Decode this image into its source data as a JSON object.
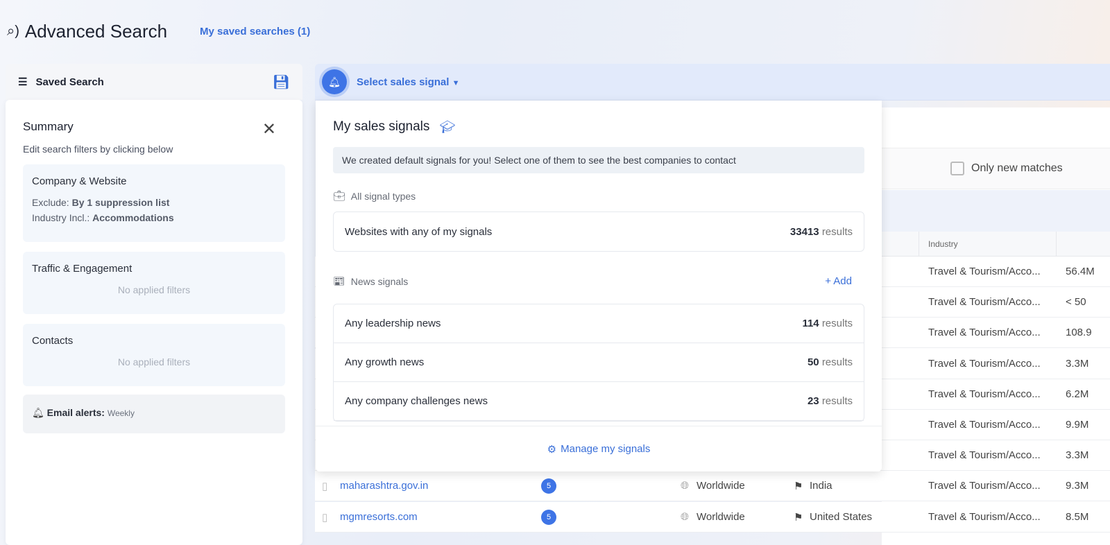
{
  "header": {
    "title": "Advanced Search",
    "saved_link": "My saved searches (1)"
  },
  "left_panel": {
    "header": "Saved Search",
    "summary_title": "Summary",
    "hint": "Edit search filters by clicking below",
    "company": {
      "title": "Company & Website",
      "exclude_label": "Exclude:",
      "exclude_value": "By 1 suppression list",
      "industry_label": "Industry Incl.:",
      "industry_value": "Accommodations"
    },
    "traffic": {
      "title": "Traffic & Engagement",
      "empty": "No applied filters"
    },
    "contacts": {
      "title": "Contacts",
      "empty": "No applied filters"
    },
    "alerts": {
      "label": "Email alerts:",
      "value": "Weekly"
    }
  },
  "signal_bar": {
    "label": "Select sales signal"
  },
  "dropdown": {
    "title": "My sales signals",
    "info": "We created default signals for you! Select one of them to see the best companies to contact",
    "all_types": "All signal types",
    "all_item": {
      "label": "Websites with any of my signals",
      "count": "33413",
      "suffix": "results"
    },
    "news": "News signals",
    "add": "Add",
    "news_items": [
      {
        "label": "Any leadership news",
        "count": "114",
        "suffix": "results"
      },
      {
        "label": "Any growth news",
        "count": "50",
        "suffix": "results"
      },
      {
        "label": "Any company challenges news",
        "count": "23",
        "suffix": "results"
      }
    ],
    "manage": "Manage my signals"
  },
  "table": {
    "only_new": "Only new matches",
    "industry_header": "Industry",
    "rows": [
      {
        "industry": "Travel & Tourism/Acco...",
        "value": "56.4M"
      },
      {
        "industry": "Travel & Tourism/Acco...",
        "value": "< 50"
      },
      {
        "industry": "Travel & Tourism/Acco...",
        "value": "108.9"
      },
      {
        "industry": "Travel & Tourism/Acco...",
        "value": "3.3M"
      },
      {
        "industry": "Travel & Tourism/Acco...",
        "value": "6.2M"
      },
      {
        "industry": "Travel & Tourism/Acco...",
        "value": "9.9M"
      },
      {
        "industry": "Travel & Tourism/Acco...",
        "value": "3.3M"
      },
      {
        "domain": "maharashtra.gov.in",
        "signals": "5",
        "scope": "Worldwide",
        "country": "India",
        "industry": "Travel & Tourism/Acco...",
        "value": "9.3M"
      },
      {
        "domain": "mgmresorts.com",
        "signals": "5",
        "scope": "Worldwide",
        "country": "United States",
        "industry": "Travel & Tourism/Acco...",
        "value": "8.5M"
      }
    ]
  },
  "colors": {
    "accent": "#3a6fd8",
    "bell": "#3e74e6"
  }
}
